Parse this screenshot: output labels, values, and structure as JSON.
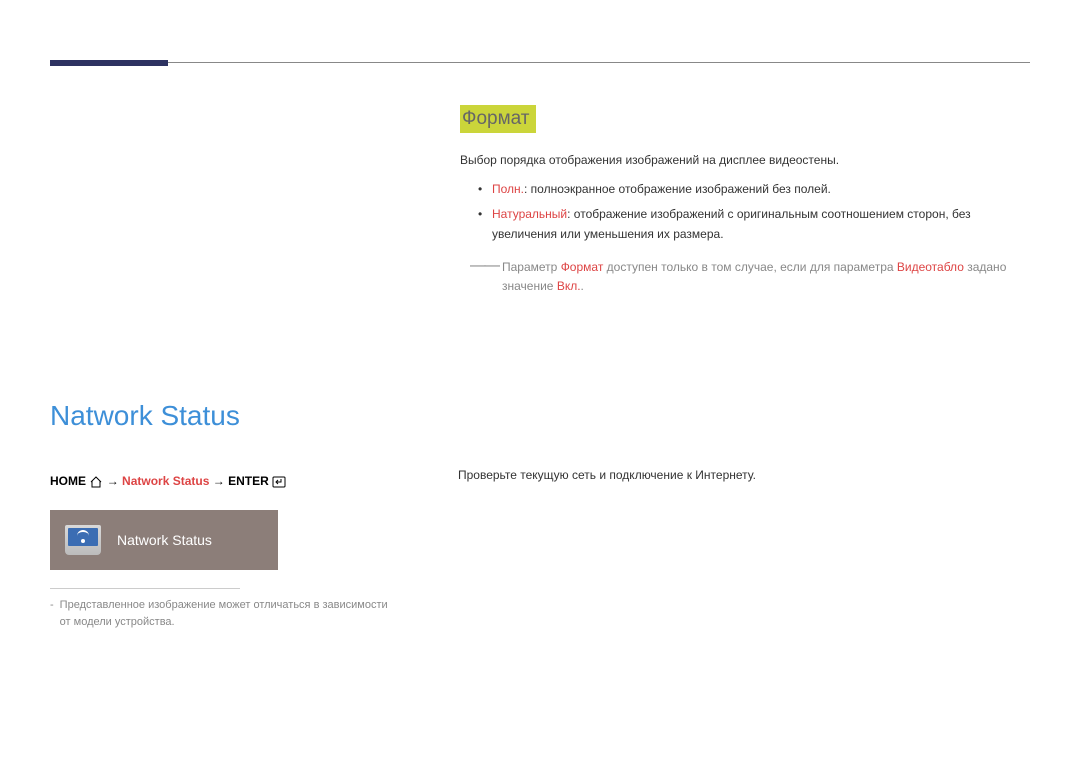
{
  "format_section": {
    "heading": "Формат",
    "intro": "Выбор порядка отображения изображений на дисплее видеостены.",
    "bullets": [
      {
        "label": "Полн.",
        "text": ": полноэкранное отображение изображений без полей."
      },
      {
        "label": "Натуральный",
        "text": ": отображение изображений с оригинальным соотношением сторон, без увеличения или уменьшения их размера."
      }
    ],
    "note": {
      "pre": "Параметр ",
      "hl1": "Формат",
      "mid": " доступен только в том случае, если для параметра ",
      "hl2": "Видеотабло",
      "post": " задано значение ",
      "hl3": "Вкл.",
      "end": "."
    }
  },
  "network_section": {
    "title": "Natwork Status",
    "breadcrumb": {
      "home": "HOME",
      "arrow": " → ",
      "navname": "Natwork Status",
      "enter": "ENTER"
    },
    "tile_label": "Natwork Status",
    "footnote": "Представленное изображение может отличаться в зависимости от модели устройства.",
    "description": "Проверьте текущую сеть и подключение к Интернету."
  }
}
